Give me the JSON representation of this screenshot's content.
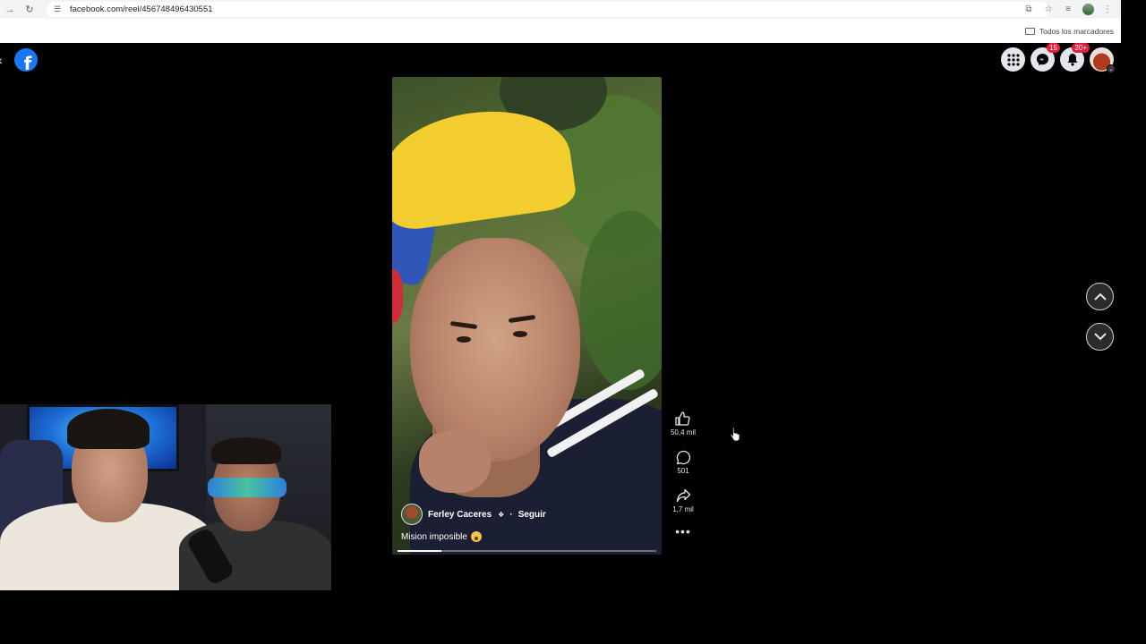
{
  "browser": {
    "url": "facebook.com/reel/456748496430551",
    "bookmarks_label": "Todos los marcadores"
  },
  "facebook": {
    "messenger_badge": "15",
    "notifications_badge": "20+"
  },
  "reel": {
    "author": "Ferley Caceres",
    "follow_separator": "·",
    "follow_label": "Seguir",
    "caption": "Mision imposible",
    "progress": 0.17,
    "likes": "50,4 mil",
    "comments": "501",
    "shares": "1,7 mil"
  },
  "icons": {
    "back": "arrow-left-icon",
    "forward": "arrow-right-icon",
    "reload": "reload-icon",
    "site_info": "tune-icon",
    "install": "install-icon",
    "star": "star-icon",
    "menu": "kebab-icon",
    "apps": "grid-menu-icon",
    "messenger": "messenger-icon",
    "notifications": "bell-icon",
    "like": "thumb-up-icon",
    "comment": "comment-icon",
    "share": "share-icon",
    "more": "more-dots-icon",
    "prev": "chevron-up-icon",
    "next": "chevron-down-icon"
  },
  "colors": {
    "facebook_blue": "#1877f2",
    "badge_red": "#e41e3f",
    "background": "#000000"
  }
}
